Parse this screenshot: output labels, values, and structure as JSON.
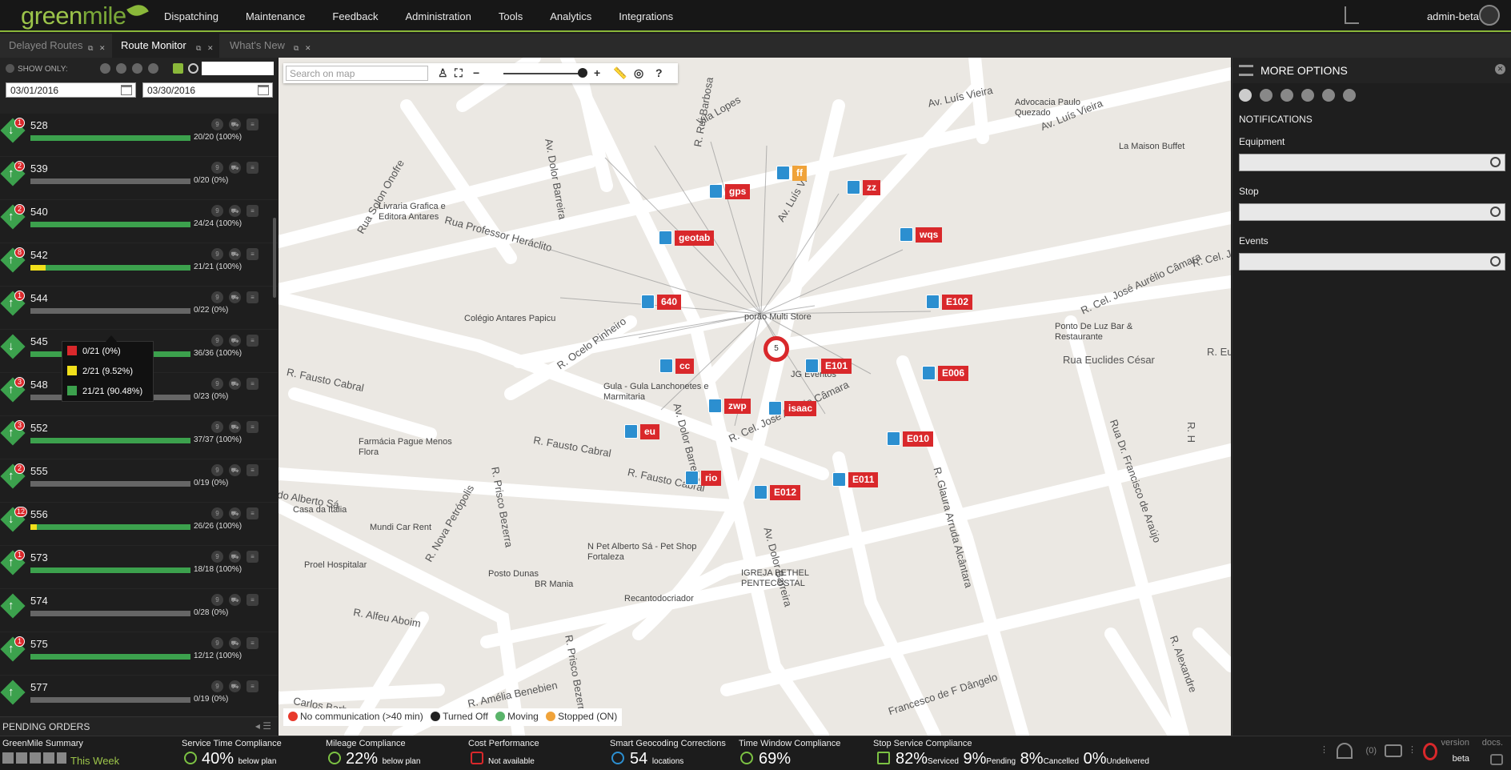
{
  "app": {
    "logo_main": "green",
    "logo_accent": "mile",
    "user": "admin-beta"
  },
  "nav": {
    "items": [
      "Dispatching",
      "Maintenance",
      "Feedback",
      "Administration",
      "Tools",
      "Analytics",
      "Integrations"
    ]
  },
  "tabs": [
    {
      "label": "Delayed Routes",
      "active": false
    },
    {
      "label": "Route Monitor",
      "active": true
    },
    {
      "label": "What's New",
      "active": false
    }
  ],
  "filters": {
    "show_only": "SHOW ONLY:",
    "date_from": "03/01/2016",
    "date_to": "03/30/2016"
  },
  "routes": [
    {
      "id": "528",
      "badge": "1",
      "count": "20/20 (100%)",
      "green": 1.0,
      "yellow": 0.0,
      "dir": "down"
    },
    {
      "id": "539",
      "badge": "2",
      "count": "0/20 (0%)",
      "green": 0.0,
      "yellow": 0.0,
      "dir": "up"
    },
    {
      "id": "540",
      "badge": "2",
      "count": "24/24 (100%)",
      "green": 1.0,
      "yellow": 0.0,
      "dir": "up"
    },
    {
      "id": "542",
      "badge": "8",
      "count": "21/21 (100%)",
      "green": 0.9048,
      "yellow": 0.0952,
      "dir": "up"
    },
    {
      "id": "544",
      "badge": "1",
      "count": "0/22 (0%)",
      "green": 0.0,
      "yellow": 0.0,
      "dir": "up"
    },
    {
      "id": "545",
      "badge": "",
      "count": "36/36 (100%)",
      "green": 1.0,
      "yellow": 0.0,
      "dir": "down"
    },
    {
      "id": "548",
      "badge": "3",
      "count": "0/23 (0%)",
      "green": 0.0,
      "yellow": 0.0,
      "dir": "up"
    },
    {
      "id": "552",
      "badge": "3",
      "count": "37/37 (100%)",
      "green": 1.0,
      "yellow": 0.0,
      "dir": "up"
    },
    {
      "id": "555",
      "badge": "2",
      "count": "0/19 (0%)",
      "green": 0.0,
      "yellow": 0.0,
      "dir": "up"
    },
    {
      "id": "556",
      "badge": "12",
      "count": "26/26 (100%)",
      "green": 0.96,
      "yellow": 0.04,
      "dir": "down"
    },
    {
      "id": "573",
      "badge": "1",
      "count": "18/18 (100%)",
      "green": 1.0,
      "yellow": 0.0,
      "dir": "up"
    },
    {
      "id": "574",
      "badge": "",
      "count": "0/28 (0%)",
      "green": 0.0,
      "yellow": 0.0,
      "dir": "up"
    },
    {
      "id": "575",
      "badge": "1",
      "count": "12/12 (100%)",
      "green": 1.0,
      "yellow": 0.0,
      "dir": "up"
    },
    {
      "id": "577",
      "badge": "",
      "count": "0/19 (0%)",
      "green": 0.0,
      "yellow": 0.0,
      "dir": "up"
    }
  ],
  "tooltip": {
    "red": "0/21 (0%)",
    "yellow": "2/21 (9.52%)",
    "green": "21/21 (90.48%)"
  },
  "pending": "PENDING ORDERS",
  "map": {
    "search_placeholder": "Search on map",
    "streets": [
      "Av. Luís Vieira",
      "Av. Luís Vieira",
      "Vila Lopes",
      "Av. Dolor Barreira",
      "R. Rui Barbosa",
      "Rua Professor Heráclito",
      "Rua Solon Onofre",
      "R. Ocelo Pinheiro",
      "R. Fausto Cabral",
      "R. Fausto Cabral",
      "R. Fausto Cabral",
      "R. Cel. José Aurélio Câmara",
      "R. Cel. José Aurélio Câmara",
      "Rua Euclides César",
      "Rua Dr. Francisco de Araújo",
      "R. Glaura Arruda Alcântara",
      "R. Prisco Bezerra",
      "R. Prisco Bezerra",
      "R. Nova Petrópolis",
      "R. Alfeu Aboim",
      "R. Amélia Benebien",
      "Carlos Barbosa",
      "Francesco de F Dângelo",
      "R. Alexandre",
      "do Alberto Sá",
      "Av. Dolor Barreira",
      "Av. Dolor Barreira",
      "Av. Luís Vi",
      "R. Cel. José Aurélio Câmar",
      "R. Eu",
      "R. H"
    ],
    "pois": [
      "Advocacia Paulo Quezado",
      "La Maison Buffet",
      "Livraria Grafica e Editora Antares",
      "Colégio Antares Papicu",
      "porão Multi Store",
      "Ponto De Luz Bar & Restaurante",
      "Gula - Gula Lanchonetes e Marmitaria",
      "JG Eventos",
      "Farmácia Pague Menos Flora",
      "Casa da Italia",
      "Mundi Car Rent",
      "Proel Hospitalar",
      "Posto Dunas",
      "BR Mania",
      "N Pet Alberto Sá - Pet Shop Fortaleza",
      "Recantodocriador",
      "IGREJA BETHEL PENTECOSTAL"
    ],
    "trucks": [
      {
        "label": "gps",
        "color": "red"
      },
      {
        "label": "ff",
        "color": "orange"
      },
      {
        "label": "zz",
        "color": "red"
      },
      {
        "label": "geotab",
        "color": "red"
      },
      {
        "label": "wqs",
        "color": "red"
      },
      {
        "label": "640",
        "color": "red"
      },
      {
        "label": "E102",
        "color": "red"
      },
      {
        "label": "cc",
        "color": "red"
      },
      {
        "label": "E101",
        "color": "red"
      },
      {
        "label": "E006",
        "color": "red"
      },
      {
        "label": "zwp",
        "color": "red"
      },
      {
        "label": "isaac",
        "color": "red"
      },
      {
        "label": "eu",
        "color": "red"
      },
      {
        "label": "E010",
        "color": "red"
      },
      {
        "label": "rio",
        "color": "red"
      },
      {
        "label": "E011",
        "color": "red"
      },
      {
        "label": "E012",
        "color": "red"
      }
    ],
    "cluster_count": "5",
    "legend": [
      "No communication (>40 min)",
      "Turned Off",
      "Moving",
      "Stopped (ON)"
    ]
  },
  "right_panel": {
    "title": "MORE OPTIONS",
    "section": "NOTIFICATIONS",
    "fields": [
      "Equipment",
      "Stop",
      "Events"
    ]
  },
  "footer": {
    "summary_title": "GreenMile Summary",
    "summary_period": "This Week",
    "metrics": [
      {
        "title": "Service Time Compliance",
        "value": "40%",
        "suffix": "below plan"
      },
      {
        "title": "Mileage Compliance",
        "value": "22%",
        "suffix": "below plan"
      },
      {
        "title": "Cost Performance",
        "value": "",
        "suffix": "Not available"
      },
      {
        "title": "Smart Geocoding Corrections",
        "value": "54",
        "suffix": "locations"
      },
      {
        "title": "Time Window Compliance",
        "value": "69%",
        "suffix": ""
      }
    ],
    "stop_service": {
      "title": "Stop Service Compliance",
      "serviced": "82%",
      "serviced_label": "Serviced",
      "pending": "9%",
      "pending_label": "Pending",
      "cancelled": "8%",
      "cancelled_label": "Cancelled",
      "undelivered": "0%",
      "undelivered_label": "Undelivered"
    },
    "notif_count": "(0)",
    "version_label": "version",
    "version_value": "beta",
    "docs": "docs."
  },
  "colors": {
    "accent": "#8ab83a",
    "red": "#d9282b",
    "yellow": "#f1e01b",
    "green": "#3ca14d",
    "truck_blue": "#2c8fd0"
  }
}
